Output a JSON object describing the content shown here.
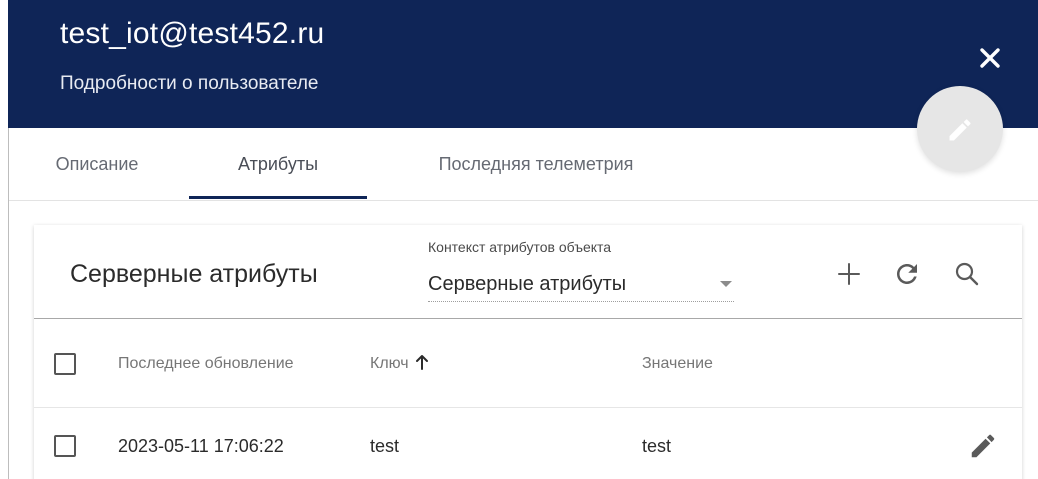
{
  "header": {
    "title": "test_iot@test452.ru",
    "subtitle": "Подробности о пользователе",
    "background_color": "#0f2557",
    "close_icon": "close-icon",
    "edit_fab_icon": "pencil-icon"
  },
  "tabs": [
    {
      "label": "Описание",
      "active": false
    },
    {
      "label": "Атрибуты",
      "active": true
    },
    {
      "label": "Последняя телеметрия",
      "active": false
    }
  ],
  "attributes_card": {
    "title": "Серверные атрибуты",
    "scope_select": {
      "label": "Контекст атрибутов объекта",
      "value": "Серверные атрибуты"
    },
    "toolbar": {
      "add_icon": "plus-icon",
      "refresh_icon": "refresh-icon",
      "search_icon": "search-icon"
    },
    "table": {
      "columns": [
        "Последнее обновление",
        "Ключ",
        "Значение"
      ],
      "sort_column": "Ключ",
      "sort_icon": "arrow-up-icon",
      "rows": [
        {
          "last_update": "2023-05-11 17:06:22",
          "key": "test",
          "value": "test",
          "selected": false
        }
      ]
    }
  }
}
